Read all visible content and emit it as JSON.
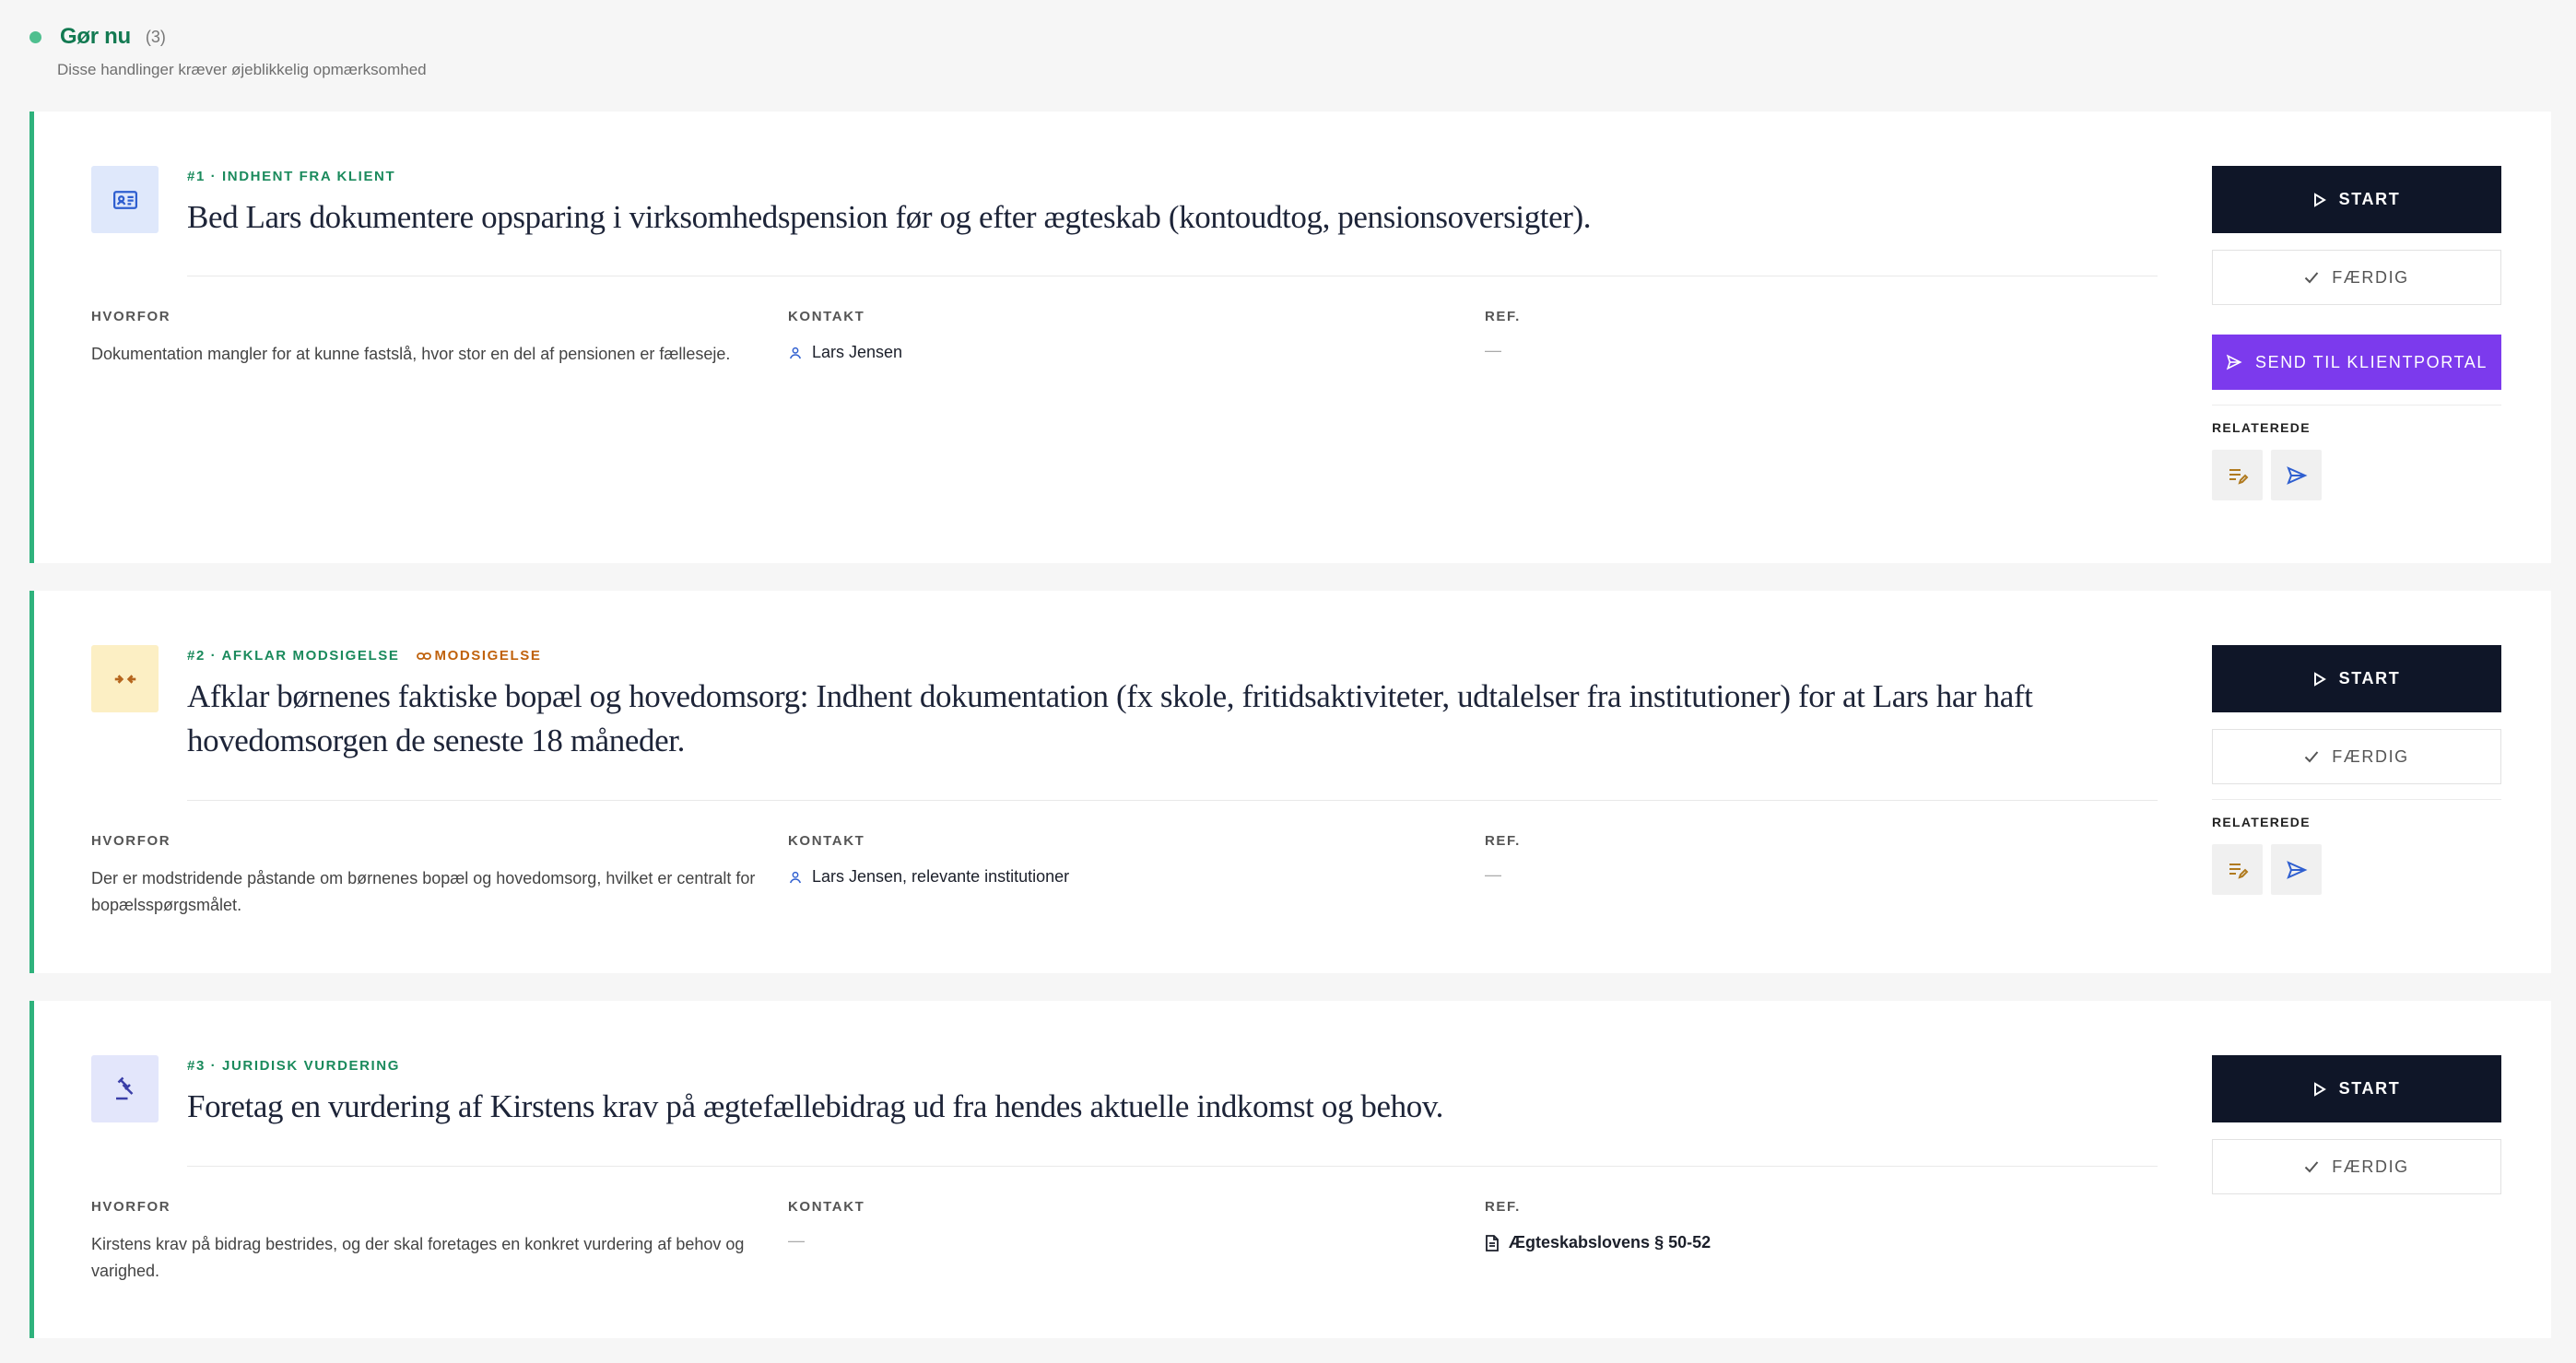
{
  "section": {
    "title": "Gør nu",
    "count": "(3)",
    "subtitle": "Disse handlinger kræver øjeblikkelig opmærksomhed"
  },
  "labels": {
    "why": "HVORFOR",
    "contact": "KONTAKT",
    "ref": "REF.",
    "related": "RELATEREDE",
    "start": "START",
    "done": "FÆRDIG",
    "send_portal": "SEND TIL KLIENTPORTAL",
    "empty": "—"
  },
  "tasks": [
    {
      "tag": "#1 · INDHENT FRA KLIENT",
      "title": "Bed Lars dokumentere opsparing i virksomhedspension før og efter ægteskab (kontoudtog, pensionsoversigter).",
      "why": "Dokumentation mangler for at kunne fastslå, hvor stor en del af pensionen er fælleseje.",
      "contact": "Lars Jensen",
      "ref": "—",
      "icon": "id-card-icon",
      "icon_bg": "#dfe8fb",
      "icon_color": "#2f5fd0"
    },
    {
      "tag": "#2 · AFKLAR MODSIGELSE",
      "contradiction": "MODSIGELSE",
      "title": "Afklar børnenes faktiske bopæl og hovedomsorg: Indhent dokumentation (fx skole, fritidsaktiviteter, udtalelser fra institutioner) for at Lars har haft hovedomsorgen de seneste 18 måneder.",
      "why": "Der er modstridende påstande om børnenes bopæl og hovedomsorg, hvilket er centralt for bopælsspørgsmålet.",
      "contact": "Lars Jensen, relevante institutioner",
      "ref": "—",
      "icon": "compress-arrows-icon",
      "icon_bg": "#fcefc4",
      "icon_color": "#b5651d"
    },
    {
      "tag": "#3 · JURIDISK VURDERING",
      "title": "Foretag en vurdering af Kirstens krav på ægtefællebidrag ud fra hendes aktuelle indkomst og behov.",
      "why": "Kirstens krav på bidrag bestrides, og der skal foretages en konkret vurdering af behov og varighed.",
      "contact": "—",
      "ref": "Ægteskabslovens § 50-52",
      "icon": "gavel-icon",
      "icon_bg": "#e3e6fb",
      "icon_color": "#3b3fa8"
    }
  ],
  "colors": {
    "accent_green": "#2fb27c",
    "tag_green": "#1a8a5c",
    "dark_button": "#0f1628",
    "purple_button": "#7c3aed",
    "contradiction_orange": "#c0620d"
  }
}
